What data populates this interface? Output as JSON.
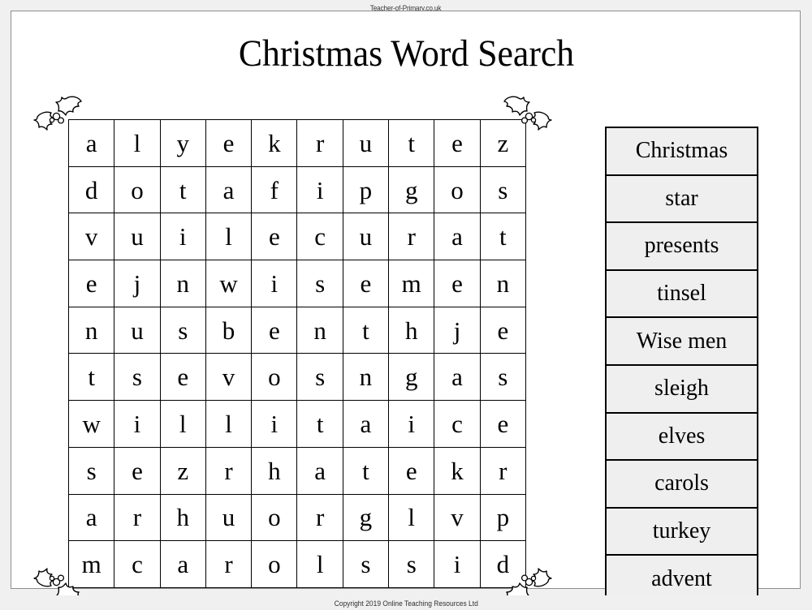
{
  "header": {
    "site": "Teacher-of-Primary.co.uk"
  },
  "title": "Christmas Word Search",
  "grid": {
    "rows": 10,
    "cols": 10,
    "letters": [
      [
        "a",
        "l",
        "y",
        "e",
        "k",
        "r",
        "u",
        "t",
        "e",
        "z"
      ],
      [
        "d",
        "o",
        "t",
        "a",
        "f",
        "i",
        "p",
        "g",
        "o",
        "s"
      ],
      [
        "v",
        "u",
        "i",
        "l",
        "e",
        "c",
        "u",
        "r",
        "a",
        "t"
      ],
      [
        "e",
        "j",
        "n",
        "w",
        "i",
        "s",
        "e",
        "m",
        "e",
        "n"
      ],
      [
        "n",
        "u",
        "s",
        "b",
        "e",
        "n",
        "t",
        "h",
        "j",
        "e"
      ],
      [
        "t",
        "s",
        "e",
        "v",
        "o",
        "s",
        "n",
        "g",
        "a",
        "s"
      ],
      [
        "w",
        "i",
        "l",
        "l",
        "i",
        "t",
        "a",
        "i",
        "c",
        "e"
      ],
      [
        "s",
        "e",
        "z",
        "r",
        "h",
        "a",
        "t",
        "e",
        "k",
        "r"
      ],
      [
        "a",
        "r",
        "h",
        "u",
        "o",
        "r",
        "g",
        "l",
        "v",
        "p"
      ],
      [
        "m",
        "c",
        "a",
        "r",
        "o",
        "l",
        "s",
        "s",
        "i",
        "d"
      ]
    ]
  },
  "wordlist": {
    "words": [
      "Christmas",
      "star",
      "presents",
      "tinsel",
      "Wise men",
      "sleigh",
      "elves",
      "carols",
      "turkey",
      "advent"
    ]
  },
  "decorations": {
    "corner_icons": [
      "holly-icon",
      "holly-icon",
      "holly-icon",
      "holly-icon"
    ]
  },
  "footer": {
    "copyright": "Copyright 2019 Online Teaching Resources Ltd"
  },
  "colors": {
    "page_background": "#f0f0f0",
    "sheet_background": "#ffffff",
    "ink": "#000000",
    "wordlist_cell": "#efefef",
    "sheet_border": "#8e8e8e"
  }
}
